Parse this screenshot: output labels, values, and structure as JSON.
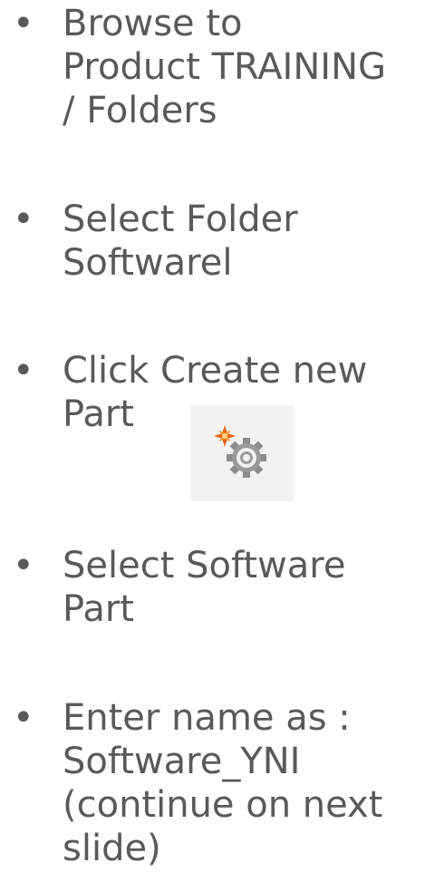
{
  "bullets": [
    {
      "symbol": "•",
      "lines": [
        "Browse to",
        "Product TRAINING",
        "/ Folders"
      ]
    },
    {
      "symbol": "•",
      "lines": [
        "Select Folder",
        "Softwarel"
      ]
    },
    {
      "symbol": "•",
      "lines": [
        "Click Create new",
        "Part"
      ]
    },
    {
      "symbol": "•",
      "lines": [
        "Select Software",
        "Part"
      ]
    },
    {
      "symbol": "•",
      "lines": [
        "Enter name as :",
        "Software_YNI",
        "(continue on next",
        "slide)"
      ]
    }
  ],
  "icon": {
    "name": "create-new-part-icon",
    "accent": "#e8641a",
    "gear": "#8c8c8c"
  }
}
